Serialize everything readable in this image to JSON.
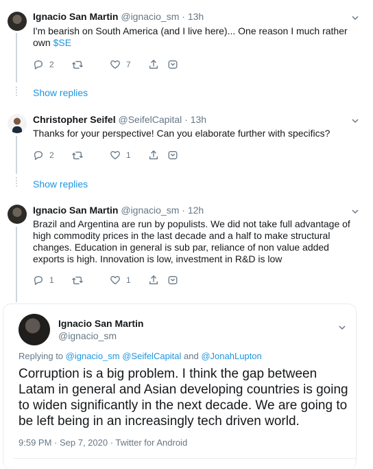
{
  "tweets": [
    {
      "name": "Ignacio San Martin",
      "handle": "@ignacio_sm",
      "time": "· 13h",
      "text_before": "I'm bearish on South America (and I live here)... One reason I much rather own ",
      "cashtag": "$SE",
      "replies": "2",
      "retweets": "",
      "likes": "7",
      "show_replies": "Show replies"
    },
    {
      "name": "Christopher Seifel",
      "handle": "@SeifelCapital",
      "time": "· 13h",
      "text": "Thanks for your perspective! Can you elaborate further with specifics?",
      "replies": "2",
      "retweets": "",
      "likes": "1",
      "show_replies": "Show replies"
    },
    {
      "name": "Ignacio San Martin",
      "handle": "@ignacio_sm",
      "time": "· 12h",
      "text": "Brazil and Argentina are run by populists. We did not take full advantage of high commodity prices in the last decade and a half to make structural changes. Education in general is sub par, reliance of non value added exports is high. Innovation is low, investment in R&D is low",
      "replies": "1",
      "retweets": "",
      "likes": "1"
    }
  ],
  "focused": {
    "name": "Ignacio San Martin",
    "handle": "@ignacio_sm",
    "replying_prefix": "Replying to ",
    "replying_to": [
      "@ignacio_sm",
      "@SeifelCapital",
      "@JonahLupton"
    ],
    "and_word": " and ",
    "text": "Corruption is a big problem. I think the gap between Latam in general and Asian developing countries is going to widen significantly in the next decade. We are going to be left being in an increasingly tech driven world.",
    "timestamp": "9:59 PM · Sep 7, 2020 · Twitter for Android"
  },
  "colors": {
    "link": "#1b95e0",
    "muted": "#657786",
    "border": "#e6ecf0"
  },
  "icons": [
    "reply-icon",
    "retweet-icon",
    "like-icon",
    "share-icon",
    "save-icon",
    "chevron-down-icon"
  ]
}
